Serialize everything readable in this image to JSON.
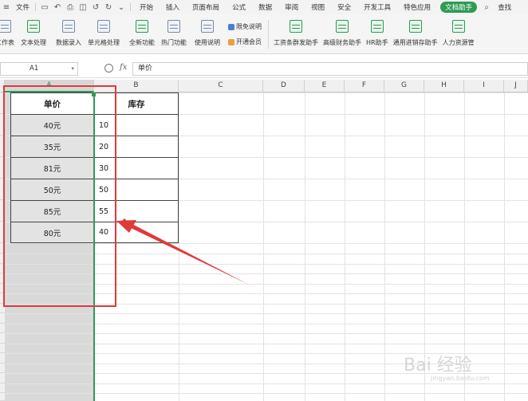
{
  "menubar": {
    "quick_icons": [
      "save-icon",
      "undo-arrow-icon",
      "print-icon",
      "preview-icon",
      "undo-icon",
      "redo-icon",
      "customize-icon"
    ],
    "file_label": "文件",
    "menus": [
      "开始",
      "插入",
      "页面布局",
      "公式",
      "数据",
      "审阅",
      "视图",
      "安全",
      "开发工具",
      "特色应用"
    ],
    "active_menu": "文档助手",
    "search_label": "查找"
  },
  "ribbon": {
    "buttons": [
      "工作表",
      "文本处理",
      "数据录入",
      "单元格处理",
      "全新功能",
      "热门功能",
      "使用说明"
    ],
    "small_items": [
      "限免说明",
      "开通会员"
    ],
    "right_buttons": [
      "工资条群发助手",
      "高级财务助手",
      "HR助手",
      "通用进销存助手",
      "人力资源管"
    ]
  },
  "formula_bar": {
    "name_box": "A1",
    "fx_label": "fx",
    "formula_value": "单价"
  },
  "columns": [
    "A",
    "B",
    "C",
    "D",
    "E",
    "F",
    "G",
    "H",
    "I",
    "J"
  ],
  "table": {
    "headers": [
      "单价",
      "库存"
    ],
    "rows": [
      [
        "40元",
        "10"
      ],
      [
        "35元",
        "20"
      ],
      [
        "81元",
        "30"
      ],
      [
        "50元",
        "50"
      ],
      [
        "85元",
        "55"
      ],
      [
        "80元",
        "40"
      ]
    ]
  },
  "watermark": {
    "text": "Bai 经验",
    "sub": "jingyan.baidu.com"
  },
  "colors": {
    "accent_green": "#2e9a54",
    "annotation_red": "#e03a3a",
    "selected_column": "#d9d9d9"
  }
}
